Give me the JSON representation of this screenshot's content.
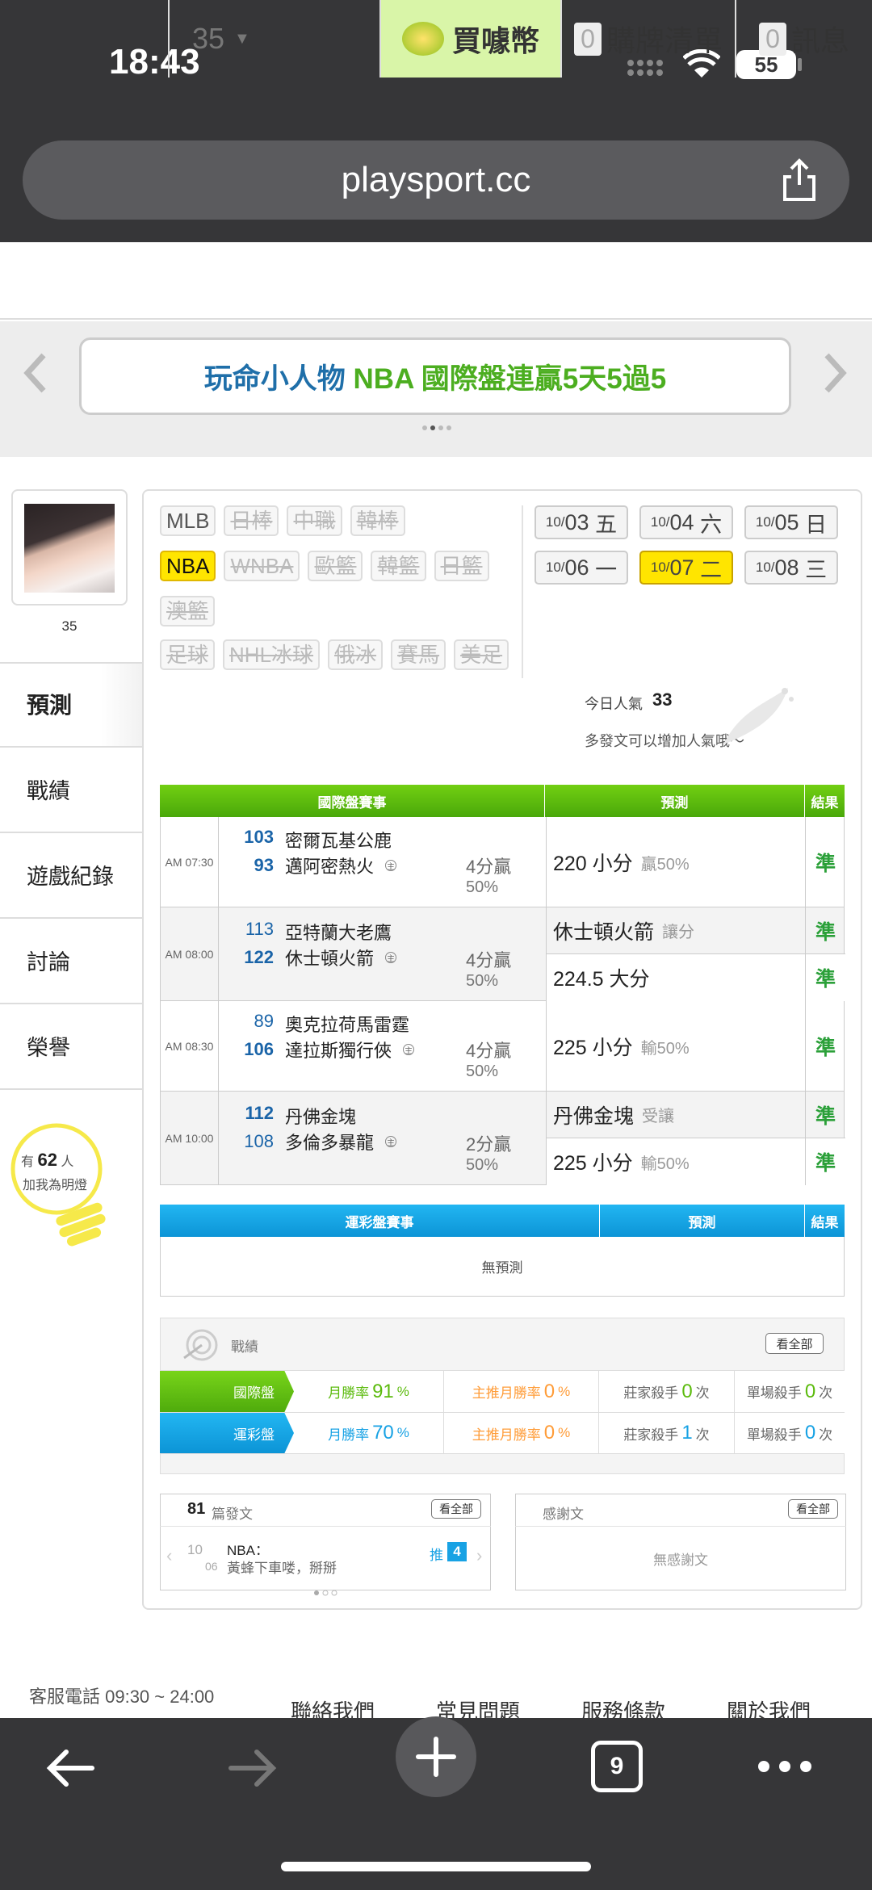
{
  "status": {
    "time": "18:43",
    "battery": "55"
  },
  "browser": {
    "url": "playsport.cc"
  },
  "userbar": {
    "points": "35",
    "buy_coin": "買噱幣",
    "cart_count": "0",
    "cart": "購牌清單",
    "msg_count": "0",
    "msg": "訊息"
  },
  "banner": {
    "prefix": "玩命小人物 ",
    "highlight": "NBA 國際盤連贏5天5過5"
  },
  "profile": {
    "name": "35"
  },
  "sidebar": {
    "tabs": [
      "預測",
      "戰績",
      "遊戲紀錄",
      "討論",
      "榮譽"
    ],
    "fan_prefix": "有",
    "fan_count": "62",
    "fan_suffix": "人",
    "fan_line2": "加我為明燈"
  },
  "filters": {
    "row1": [
      "MLB",
      "日棒",
      "中職",
      "韓棒"
    ],
    "row2": [
      "NBA",
      "WNBA",
      "歐籃",
      "韓籃",
      "日籃"
    ],
    "row3": [
      "澳籃"
    ],
    "row4": [
      "足球",
      "NHL冰球",
      "俄冰",
      "賽馬",
      "美足"
    ]
  },
  "dates": {
    "row1": [
      {
        "md": "10/",
        "d": "03",
        "w": "五"
      },
      {
        "md": "10/",
        "d": "04",
        "w": "六"
      },
      {
        "md": "10/",
        "d": "05",
        "w": "日"
      }
    ],
    "row2": [
      {
        "md": "10/",
        "d": "06",
        "w": "一"
      },
      {
        "md": "10/",
        "d": "07",
        "w": "二"
      },
      {
        "md": "10/",
        "d": "08",
        "w": "三"
      }
    ]
  },
  "popularity": {
    "label": "今日人氣",
    "value": "33",
    "hint": "多發文可以增加人氣哦～"
  },
  "intl": {
    "h_games": "國際盤賽事",
    "h_pred": "預測",
    "h_result": "結果",
    "games": [
      {
        "time": "AM 07:30",
        "a_score": "103",
        "a_team": "密爾瓦基公鹿",
        "h_score": "93",
        "h_team": "邁阿密熱火",
        "host": "主",
        "spread": "4分贏",
        "pct": "50%",
        "preds": [
          {
            "pick": "220 小分",
            "note": "贏50%",
            "result": "準"
          }
        ]
      },
      {
        "time": "AM 08:00",
        "a_score": "113",
        "a_team": "亞特蘭大老鷹",
        "h_score": "122",
        "h_team": "休士頓火箭",
        "host": "主",
        "spread": "4分贏",
        "pct": "50%",
        "preds": [
          {
            "pick": "休士頓火箭",
            "note": "讓分",
            "result": "準"
          },
          {
            "pick": "224.5 大分",
            "note": "",
            "result": "準"
          }
        ]
      },
      {
        "time": "AM 08:30",
        "a_score": "89",
        "a_team": "奧克拉荷馬雷霆",
        "h_score": "106",
        "h_team": "達拉斯獨行俠",
        "host": "主",
        "spread": "4分贏",
        "pct": "50%",
        "preds": [
          {
            "pick": "225 小分",
            "note": "輸50%",
            "result": "準"
          }
        ]
      },
      {
        "time": "AM 10:00",
        "a_score": "112",
        "a_team": "丹佛金塊",
        "h_score": "108",
        "h_team": "多倫多暴龍",
        "host": "主",
        "spread": "2分贏",
        "pct": "50%",
        "preds": [
          {
            "pick": "丹佛金塊",
            "note": "受讓",
            "result": "準"
          },
          {
            "pick": "225 小分",
            "note": "輸50%",
            "result": "準"
          }
        ]
      }
    ]
  },
  "lottery": {
    "h_games": "運彩盤賽事",
    "h_pred": "預測",
    "h_result": "結果",
    "empty": "無預測"
  },
  "record": {
    "title": "戰績",
    "see_all": "看全部",
    "rows": [
      {
        "label": "國際盤",
        "month_label": "月勝率",
        "month": "91",
        "host_label": "主推月勝率",
        "host": "0",
        "banker_label": "莊家殺手",
        "banker": "0",
        "single_label": "單場殺手",
        "single": "0"
      },
      {
        "label": "運彩盤",
        "month_label": "月勝率",
        "month": "70",
        "host_label": "主推月勝率",
        "host": "0",
        "banker_label": "莊家殺手",
        "banker": "1",
        "single_label": "單場殺手",
        "single": "0"
      }
    ],
    "pct": "%",
    "times": "次"
  },
  "posts": {
    "count": "81",
    "label": "篇發文",
    "see_all": "看全部",
    "month": "10",
    "day": "06",
    "league": "NBA：",
    "title": "黃蜂下車喽，掰掰",
    "push": "推",
    "push_count": "4"
  },
  "thanks": {
    "label": "感謝文",
    "see_all": "看全部",
    "empty": "無感謝文"
  },
  "footer": {
    "phone": "客服電話 09:30 ~ 24:00",
    "links": [
      "聯絡我們",
      "常見問題",
      "服務條款",
      "關於我們"
    ]
  },
  "toolbar": {
    "tabs": "9"
  },
  "colors": {
    "green": "#5cbb0e",
    "blue": "#18a2e4",
    "yellow": "#ffe500"
  }
}
